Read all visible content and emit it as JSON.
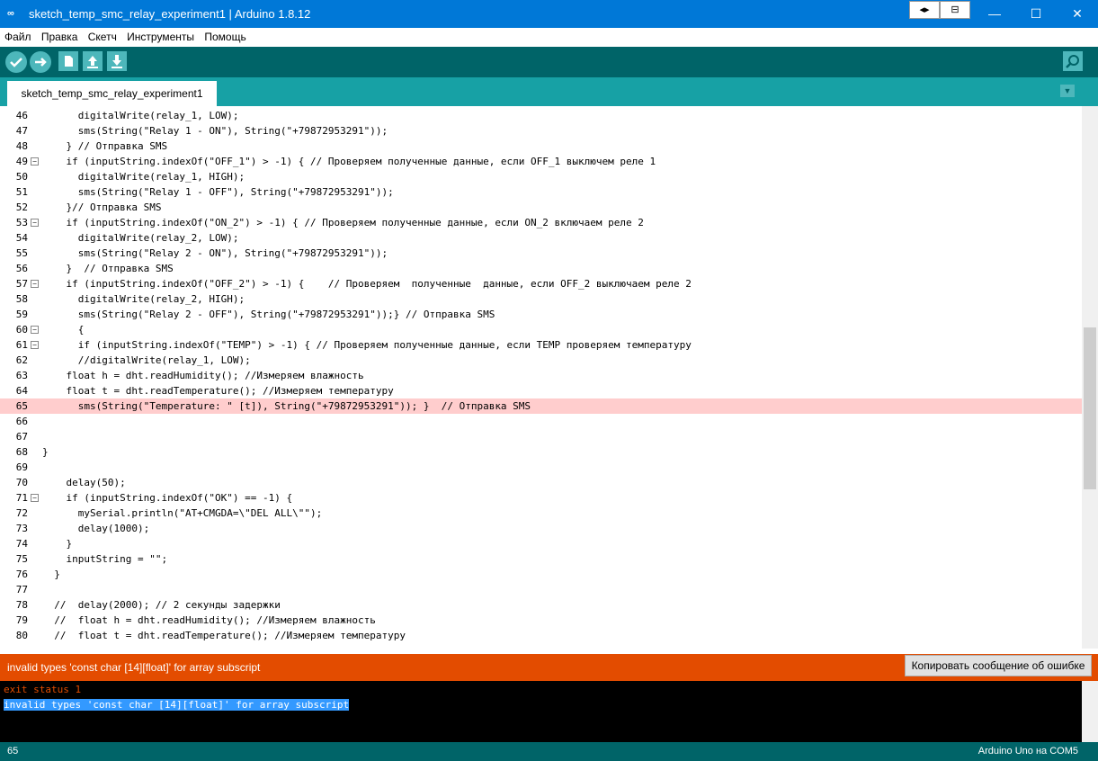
{
  "window": {
    "title": "sketch_temp_smc_relay_experiment1 | Arduino 1.8.12",
    "controls": {
      "minimize": "—",
      "maximize": "☐",
      "close": "✕"
    }
  },
  "menu": [
    "Файл",
    "Правка",
    "Скетч",
    "Инструменты",
    "Помощь"
  ],
  "tab": {
    "label": "sketch_temp_smc_relay_experiment1"
  },
  "editor": {
    "highlighted_line": 65,
    "lines": [
      {
        "n": "46",
        "t": "      digitalWrite(relay_1, LOW);"
      },
      {
        "n": "47",
        "t": "      sms(String(\"Relay 1 - ON\"), String(\"+79872953291\"));"
      },
      {
        "n": "48",
        "t": "    } // Отправка SMS"
      },
      {
        "n": "49",
        "t": "    if (inputString.indexOf(\"OFF_1\") > -1) { // Проверяем полученные данные, если OFF_1 выключем реле 1",
        "f": true
      },
      {
        "n": "50",
        "t": "      digitalWrite(relay_1, HIGH);"
      },
      {
        "n": "51",
        "t": "      sms(String(\"Relay 1 - OFF\"), String(\"+79872953291\"));"
      },
      {
        "n": "52",
        "t": "    }// Отправка SMS"
      },
      {
        "n": "53",
        "t": "    if (inputString.indexOf(\"ON_2\") > -1) { // Проверяем полученные данные, если ON_2 включаем реле 2",
        "f": true
      },
      {
        "n": "54",
        "t": "      digitalWrite(relay_2, LOW);"
      },
      {
        "n": "55",
        "t": "      sms(String(\"Relay 2 - ON\"), String(\"+79872953291\"));"
      },
      {
        "n": "56",
        "t": "    }  // Отправка SMS"
      },
      {
        "n": "57",
        "t": "    if (inputString.indexOf(\"OFF_2\") > -1) {    // Проверяем  полученные  данные, если OFF_2 выключаем реле 2",
        "f": true
      },
      {
        "n": "58",
        "t": "      digitalWrite(relay_2, HIGH);"
      },
      {
        "n": "59",
        "t": "      sms(String(\"Relay 2 - OFF\"), String(\"+79872953291\"));} // Отправка SMS"
      },
      {
        "n": "60",
        "t": "      {",
        "f": true
      },
      {
        "n": "61",
        "t": "      if (inputString.indexOf(\"TEMP\") > -1) { // Проверяем полученные данные, если TEMP проверяем температуру",
        "f": true
      },
      {
        "n": "62",
        "t": "      //digitalWrite(relay_1, LOW);"
      },
      {
        "n": "63",
        "t": "    float h = dht.readHumidity(); //Измеряем влажность"
      },
      {
        "n": "64",
        "t": "    float t = dht.readTemperature(); //Измеряем температуру"
      },
      {
        "n": "65",
        "t": "      sms(String(\"Temperature: \" [t]), String(\"+79872953291\")); }  // Отправка SMS"
      },
      {
        "n": "66",
        "t": ""
      },
      {
        "n": "67",
        "t": ""
      },
      {
        "n": "68",
        "t": "}"
      },
      {
        "n": "69",
        "t": ""
      },
      {
        "n": "70",
        "t": "    delay(50);"
      },
      {
        "n": "71",
        "t": "    if (inputString.indexOf(\"OK\") == -1) {",
        "f": true
      },
      {
        "n": "72",
        "t": "      mySerial.println(\"AT+CMGDA=\\\"DEL ALL\\\"\");"
      },
      {
        "n": "73",
        "t": "      delay(1000);"
      },
      {
        "n": "74",
        "t": "    }"
      },
      {
        "n": "75",
        "t": "    inputString = \"\";"
      },
      {
        "n": "76",
        "t": "  }"
      },
      {
        "n": "77",
        "t": ""
      },
      {
        "n": "78",
        "t": "  //  delay(2000); // 2 секунды задержки"
      },
      {
        "n": "79",
        "t": "  //  float h = dht.readHumidity(); //Измеряем влажность"
      },
      {
        "n": "80",
        "t": "  //  float t = dht.readTemperature(); //Измеряем температуру"
      }
    ]
  },
  "error_bar": {
    "message": "invalid types 'const char [14][float]' for array subscript",
    "copy_button": "Копировать сообщение об ошибке"
  },
  "console": {
    "line1": "exit status 1",
    "line2": "invalid types 'const char [14][float]' for array subscript"
  },
  "status": {
    "line": "65",
    "board": "Arduino Uno на COM5"
  },
  "colors": {
    "titlebar": "#0078d7",
    "toolbar": "#006468",
    "tabbar": "#17a1a5",
    "error": "#e34c00",
    "highlight": "#ffcdcd"
  }
}
